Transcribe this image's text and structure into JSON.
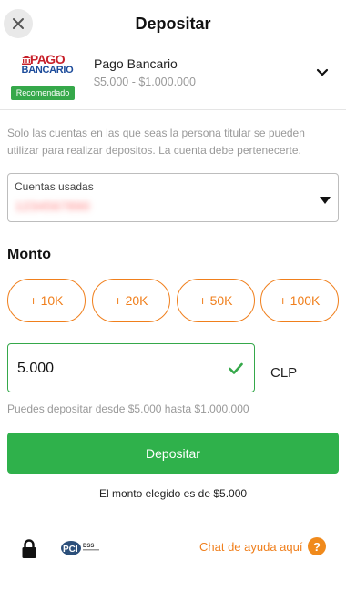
{
  "header": {
    "title": "Depositar"
  },
  "method": {
    "logo_line1": "PAGO",
    "logo_line2": "BANCARIO",
    "badge": "Recomendado",
    "name": "Pago Bancario",
    "range": "$5.000 - $1.000.000"
  },
  "info_text": "Solo las cuentas en las que seas la persona titular se pueden utilizar para realizar depositos. La cuenta debe pertenecerte.",
  "account": {
    "label": "Cuentas usadas",
    "value": "1234567890"
  },
  "monto": {
    "label": "Monto",
    "chips": [
      "+ 10K",
      "+ 20K",
      "+ 50K",
      "+ 100K"
    ]
  },
  "amount": {
    "value": "5.000",
    "currency": "CLP"
  },
  "range_hint": "Puedes depositar desde $5.000 hasta $1.000.000",
  "deposit_button": "Depositar",
  "chosen_text": "El monto elegido es de $5.000",
  "footer": {
    "pci_text": "PCI",
    "pci_sub": "DSS",
    "help_link": "Chat de ayuda aquí",
    "help_icon": "?"
  },
  "colors": {
    "accent": "#f07f1c",
    "success": "#2fb14b",
    "badge": "#35a84a"
  }
}
